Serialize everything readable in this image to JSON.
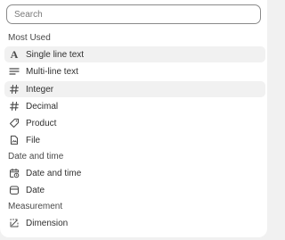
{
  "search": {
    "placeholder": "Search",
    "value": ""
  },
  "sections": {
    "most_used": "Most Used",
    "date_and_time": "Date and time",
    "measurement": "Measurement"
  },
  "items": {
    "single_line_text": "Single line text",
    "multi_line_text": "Multi-line text",
    "integer": "Integer",
    "decimal": "Decimal",
    "product": "Product",
    "file": "File",
    "date_and_time": "Date and time",
    "date": "Date",
    "dimension": "Dimension"
  },
  "icons": {
    "single_line_text": "text-A-icon",
    "multi_line_text": "paragraph-lines-icon",
    "integer": "hash-icon",
    "decimal": "hash-icon",
    "product": "product-tag-icon",
    "file": "file-icon",
    "date_and_time": "calendar-clock-icon",
    "date": "calendar-icon",
    "dimension": "ruler-icon"
  },
  "colors": {
    "highlight": "#f1f1f1",
    "text": "#303030",
    "muted": "#4a4a4a"
  }
}
